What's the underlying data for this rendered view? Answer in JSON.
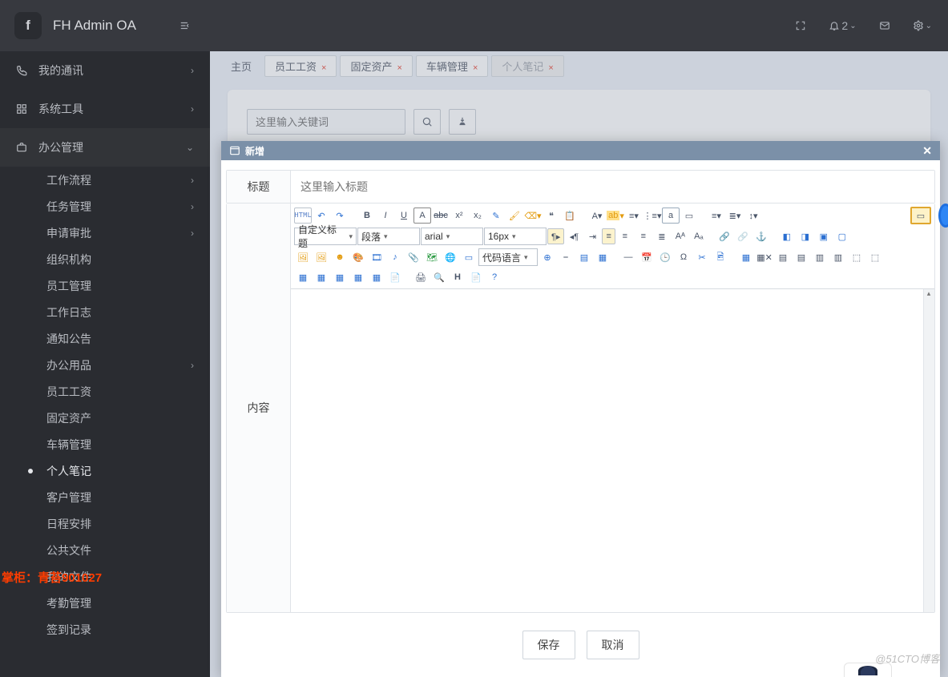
{
  "brand": "FH Admin OA",
  "header": {
    "bell_count": "2"
  },
  "sidebar": {
    "top": [
      {
        "label": "我的通讯",
        "chev": "›"
      },
      {
        "label": "系统工具",
        "chev": "›"
      },
      {
        "label": "办公管理",
        "chev": "⌄",
        "expanded": true
      }
    ],
    "sub": [
      {
        "label": "工作流程",
        "chev": "›"
      },
      {
        "label": "任务管理",
        "chev": "›"
      },
      {
        "label": "申请审批",
        "chev": "›"
      },
      {
        "label": "组织机构"
      },
      {
        "label": "员工管理"
      },
      {
        "label": "工作日志"
      },
      {
        "label": "通知公告"
      },
      {
        "label": "办公用品",
        "chev": "›"
      },
      {
        "label": "员工工资"
      },
      {
        "label": "固定资产"
      },
      {
        "label": "车辆管理"
      },
      {
        "label": "个人笔记",
        "active": true
      },
      {
        "label": "客户管理"
      },
      {
        "label": "日程安排"
      },
      {
        "label": "公共文件"
      },
      {
        "label": "我的文件"
      },
      {
        "label": "考勤管理"
      },
      {
        "label": "签到记录"
      }
    ]
  },
  "owner_watermark": "掌柜：青苔901027",
  "tabs": [
    {
      "label": "主页",
      "home": true
    },
    {
      "label": "员工工资",
      "close": true
    },
    {
      "label": "固定资产",
      "close": true
    },
    {
      "label": "车辆管理",
      "close": true
    },
    {
      "label": "个人笔记",
      "close": true,
      "active": true
    }
  ],
  "search": {
    "placeholder": "这里输入关键词"
  },
  "modal": {
    "title": "新增",
    "row_title_label": "标题",
    "row_title_placeholder": "这里输入标题",
    "row_content_label": "内容",
    "html_btn": "HTML",
    "sel_style": "自定义标题",
    "sel_para": "段落",
    "sel_font": "arial",
    "sel_size": "16px",
    "sel_codelang": "代码语言",
    "save": "保存",
    "cancel": "取消"
  },
  "footer_wm": "@51CTO博客"
}
